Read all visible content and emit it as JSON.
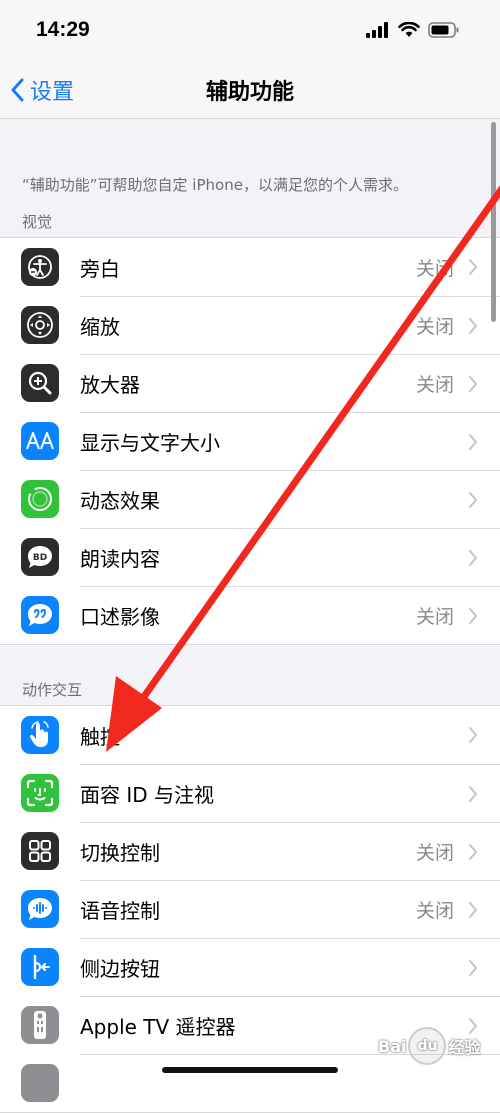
{
  "status_bar": {
    "time": "14:29"
  },
  "nav": {
    "back_label": "设置",
    "title": "辅助功能"
  },
  "description": "“辅助功能”可帮助您自定 iPhone，以满足您的个人需求。",
  "sections": [
    {
      "header": "视觉",
      "items": [
        {
          "label": "旁白",
          "value": "关闭",
          "icon": "voiceover-icon",
          "icon_color": "#2c2c2e"
        },
        {
          "label": "缩放",
          "value": "关闭",
          "icon": "zoom-icon",
          "icon_color": "#2c2c2e"
        },
        {
          "label": "放大器",
          "value": "关闭",
          "icon": "magnifier-icon",
          "icon_color": "#2c2c2e"
        },
        {
          "label": "显示与文字大小",
          "value": "",
          "icon": "text-size-icon",
          "icon_color": "#0a84ff"
        },
        {
          "label": "动态效果",
          "value": "",
          "icon": "motion-icon",
          "icon_color": "#30c23a"
        },
        {
          "label": "朗读内容",
          "value": "",
          "icon": "spoken-content-icon",
          "icon_color": "#2c2c2e"
        },
        {
          "label": "口述影像",
          "value": "关闭",
          "icon": "audio-description-icon",
          "icon_color": "#0a84ff"
        }
      ]
    },
    {
      "header": "动作交互",
      "items": [
        {
          "label": "触控",
          "value": "",
          "icon": "touch-icon",
          "icon_color": "#0a84ff"
        },
        {
          "label": "面容 ID 与注视",
          "value": "",
          "icon": "face-id-icon",
          "icon_color": "#30c23a"
        },
        {
          "label": "切换控制",
          "value": "关闭",
          "icon": "switch-control-icon",
          "icon_color": "#2c2c2e"
        },
        {
          "label": "语音控制",
          "value": "关闭",
          "icon": "voice-control-icon",
          "icon_color": "#0a84ff"
        },
        {
          "label": "侧边按钮",
          "value": "",
          "icon": "side-button-icon",
          "icon_color": "#0a84ff"
        },
        {
          "label": "Apple TV 遥控器",
          "value": "",
          "icon": "apple-tv-remote-icon",
          "icon_color": "#8e8e93"
        }
      ]
    }
  ],
  "colors": {
    "accent": "#1a7cf5",
    "annotation_arrow": "#f0281e"
  },
  "watermark": {
    "text": "Bai 经验",
    "paw": "du"
  }
}
